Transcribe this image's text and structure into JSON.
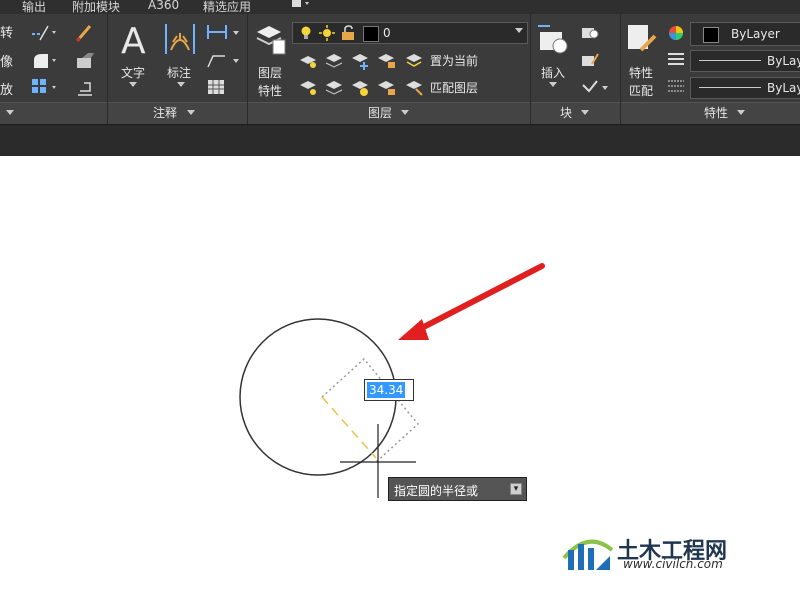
{
  "ribbon": {
    "tabs": [
      "输出",
      "附加模块",
      "A360",
      "精选应用"
    ],
    "panels": {
      "modify": {
        "items": [
          "转",
          "像",
          "放"
        ]
      },
      "annotation": {
        "title": "注释",
        "text_label": "文字",
        "dim_label": "标注"
      },
      "layers": {
        "title": "图层",
        "props_label": [
          "图层",
          "特性"
        ],
        "current_layer": "0",
        "set_current": "置为当前",
        "match_layer": "匹配图层"
      },
      "block": {
        "title": "块",
        "insert_label": "插入"
      },
      "properties": {
        "title": "特性",
        "match_label": [
          "特性",
          "匹配"
        ],
        "color": "ByLayer",
        "linetype": "ByLay",
        "lineweight": "ByLay"
      }
    }
  },
  "canvas": {
    "dynamic_input_value": "34.34",
    "command_prompt": "指定圆的半径或"
  },
  "watermark": {
    "name": "土木工程网",
    "url": "www.civilcn.com"
  },
  "colors": {
    "ribbon_bg": "#3b3b3b",
    "arrow_red": "#e02020",
    "radius_dash": "#e8c44a",
    "highlight": "#3399ff"
  }
}
